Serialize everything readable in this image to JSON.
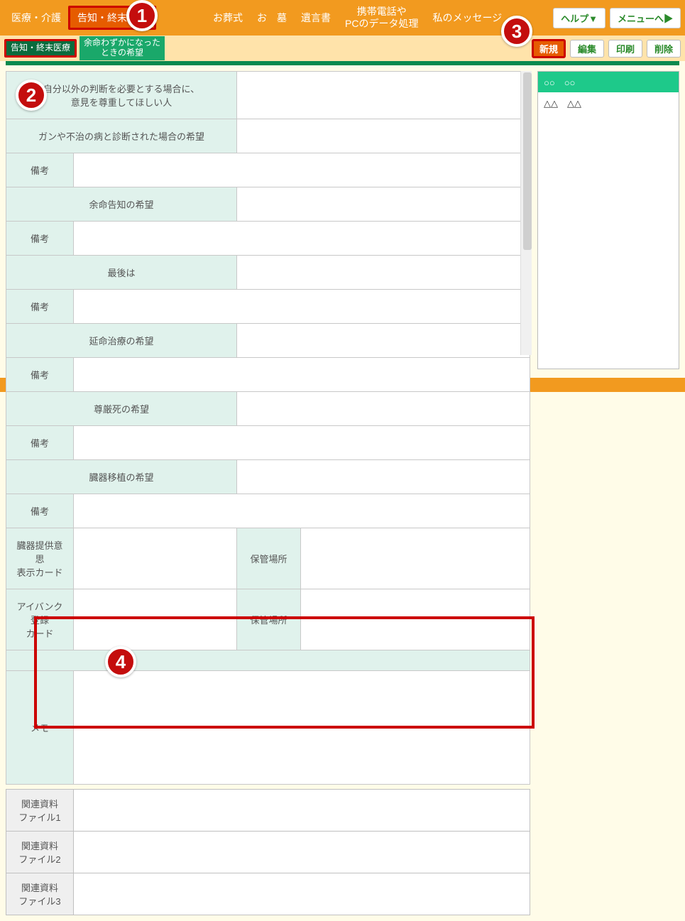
{
  "nav": {
    "items": [
      "医療・介護",
      "告知・終末医療",
      "お葬式",
      "お　墓",
      "遺言書",
      "携帯電話や\nPCのデータ処理",
      "私のメッセージ"
    ],
    "help": "ヘルプ▼",
    "menu": "メニューへ▶"
  },
  "subtabs": {
    "tab1": "告知・終末医療",
    "tab2": "余命わずかになった\nときの希望"
  },
  "actions": {
    "new": "新規",
    "edit": "編集",
    "print": "印刷",
    "del": "削除"
  },
  "form": {
    "r1": "自分以外の判断を必要とする場合に、\n意見を尊重してほしい人",
    "r2": "ガンや不治の病と診断された場合の希望",
    "biko": "備考",
    "r3": "余命告知の希望",
    "r4": "最後は",
    "r5": "延命治療の希望",
    "r6": "尊厳死の希望",
    "r7": "臓器移植の希望",
    "r8a": "臓器提供意思\n表示カード",
    "r8b": "保管場所",
    "r9a": "アイバンク登録\nカード",
    "r9b": "保管場所",
    "memo": "メモ",
    "file1": "関連資料\nファイル1",
    "file2": "関連資料\nファイル2",
    "file3": "関連資料\nファイル3"
  },
  "side": {
    "row1": "○○　○○",
    "row2": "△△　△△"
  },
  "badges": {
    "b1": "1",
    "b2": "2",
    "b3": "3",
    "b4": "4"
  }
}
